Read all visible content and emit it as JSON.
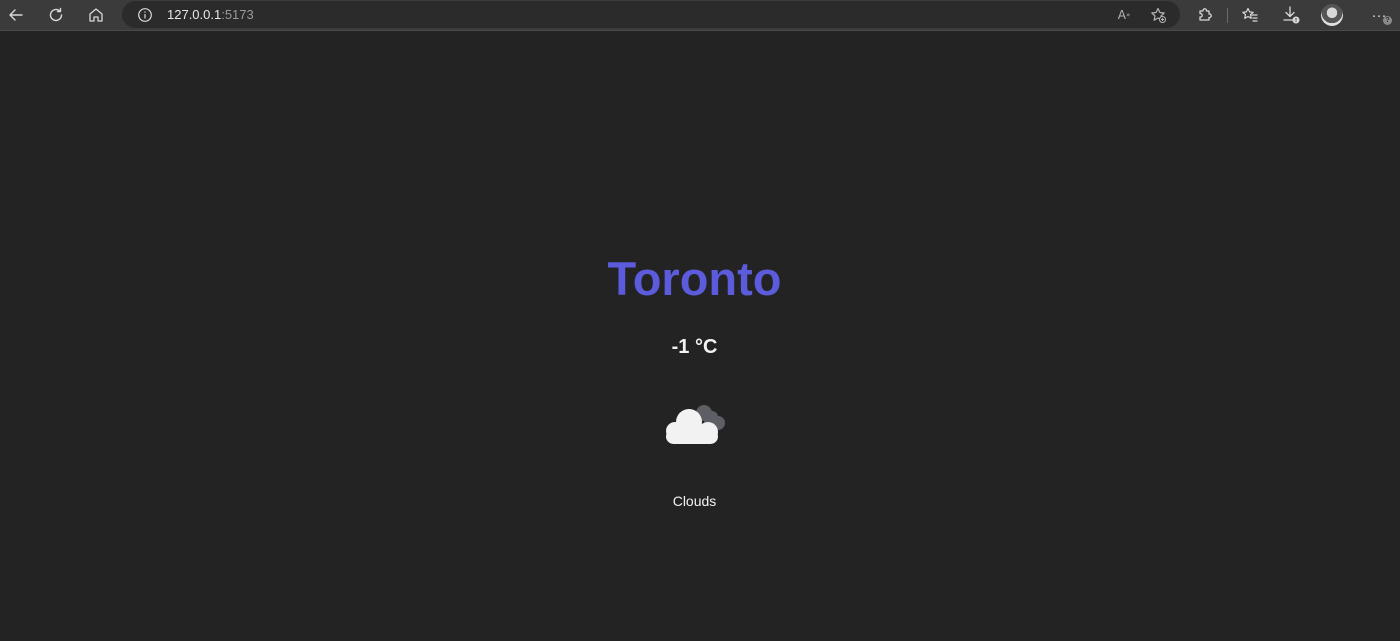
{
  "browser": {
    "url_host": "127.0.0.1",
    "url_port": ":5173",
    "read_aloud_label": "A",
    "read_aloud_sup": "»",
    "more_label": "···",
    "help_badge": "?"
  },
  "icons": {
    "back": "arrow-left-icon",
    "refresh": "refresh-icon",
    "home": "home-icon",
    "info": "info-icon",
    "favorite": "star-add-icon",
    "extensions": "puzzle-icon",
    "favorites": "favorites-icon",
    "downloads": "download-icon",
    "weather": "cloud-icon"
  },
  "weather": {
    "city": "Toronto",
    "temperature": "-1 °C",
    "condition": "Clouds"
  },
  "colors": {
    "city": "#5b5bdc",
    "background": "#232323",
    "text": "#f2f2f2"
  }
}
